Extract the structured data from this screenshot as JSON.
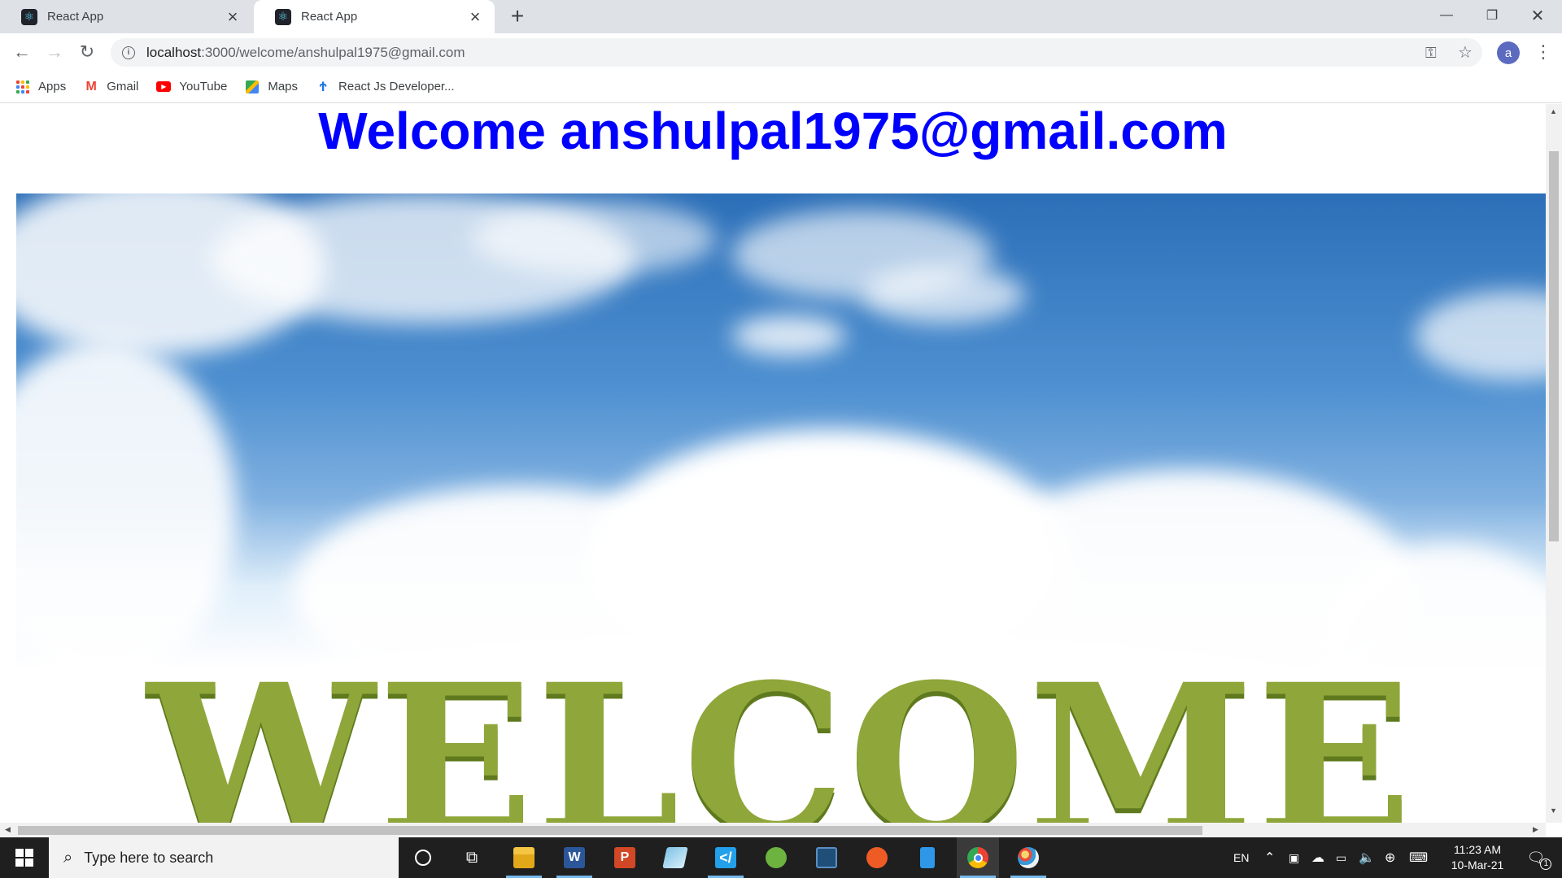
{
  "browser": {
    "tabs": [
      {
        "title": "React App",
        "active": false
      },
      {
        "title": "React App",
        "active": true
      }
    ],
    "url_host": "localhost",
    "url_path": ":3000/welcome/anshulpal1975@gmail.com",
    "avatar_letter": "a",
    "bookmarks": [
      {
        "label": "Apps",
        "icon": "apps-grid-icon"
      },
      {
        "label": "Gmail",
        "icon": "gmail-icon"
      },
      {
        "label": "YouTube",
        "icon": "youtube-icon"
      },
      {
        "label": "Maps",
        "icon": "maps-icon"
      },
      {
        "label": "React Js Developer...",
        "icon": "bookmark-site-icon"
      }
    ]
  },
  "page": {
    "heading": "Welcome anshulpal1975@gmail.com",
    "hero_text": "WELCOME",
    "heading_color": "#0000ff"
  },
  "taskbar": {
    "search_placeholder": "Type here to search",
    "language": "EN",
    "time": "11:23 AM",
    "date": "10-Mar-21",
    "notification_count": "1"
  }
}
